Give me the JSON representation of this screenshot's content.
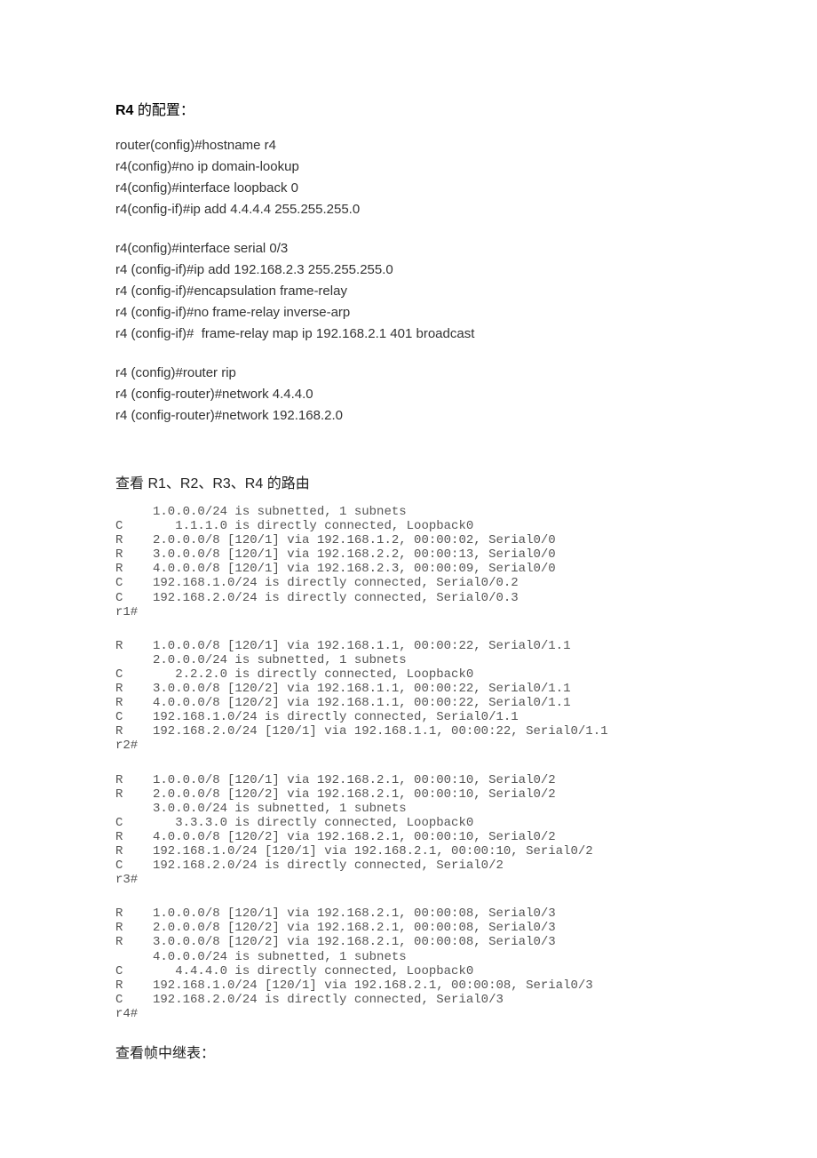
{
  "heading": {
    "bold": "R4",
    "rest": " 的配置："
  },
  "block1": [
    "router(config)#hostname r4",
    "r4(config)#no ip domain-lookup",
    "r4(config)#interface loopback 0",
    "r4(config-if)#ip add 4.4.4.4 255.255.255.0"
  ],
  "block2": [
    "r4(config)#interface serial 0/3",
    "r4 (config-if)#ip add 192.168.2.3 255.255.255.0",
    "r4 (config-if)#encapsulation frame-relay",
    "r4 (config-if)#no frame-relay inverse-arp",
    "r4 (config-if)#  frame-relay map ip 192.168.2.1 401 broadcast"
  ],
  "block3": [
    "r4 (config)#router rip",
    "r4 (config-router)#network 4.4.4.0",
    "r4 (config-router)#network 192.168.2.0"
  ],
  "sec_routes_title": "查看 R1、R2、R3、R4 的路由",
  "term1": "     1.0.0.0/24 is subnetted, 1 subnets\nC       1.1.1.0 is directly connected, Loopback0\nR    2.0.0.0/8 [120/1] via 192.168.1.2, 00:00:02, Serial0/0\nR    3.0.0.0/8 [120/1] via 192.168.2.2, 00:00:13, Serial0/0\nR    4.0.0.0/8 [120/1] via 192.168.2.3, 00:00:09, Serial0/0\nC    192.168.1.0/24 is directly connected, Serial0/0.2\nC    192.168.2.0/24 is directly connected, Serial0/0.3\nr1#",
  "term2": "R    1.0.0.0/8 [120/1] via 192.168.1.1, 00:00:22, Serial0/1.1\n     2.0.0.0/24 is subnetted, 1 subnets\nC       2.2.2.0 is directly connected, Loopback0\nR    3.0.0.0/8 [120/2] via 192.168.1.1, 00:00:22, Serial0/1.1\nR    4.0.0.0/8 [120/2] via 192.168.1.1, 00:00:22, Serial0/1.1\nC    192.168.1.0/24 is directly connected, Serial0/1.1\nR    192.168.2.0/24 [120/1] via 192.168.1.1, 00:00:22, Serial0/1.1\nr2#",
  "term3": "R    1.0.0.0/8 [120/1] via 192.168.2.1, 00:00:10, Serial0/2\nR    2.0.0.0/8 [120/2] via 192.168.2.1, 00:00:10, Serial0/2\n     3.0.0.0/24 is subnetted, 1 subnets\nC       3.3.3.0 is directly connected, Loopback0\nR    4.0.0.0/8 [120/2] via 192.168.2.1, 00:00:10, Serial0/2\nR    192.168.1.0/24 [120/1] via 192.168.2.1, 00:00:10, Serial0/2\nC    192.168.2.0/24 is directly connected, Serial0/2\nr3#",
  "term4": "R    1.0.0.0/8 [120/1] via 192.168.2.1, 00:00:08, Serial0/3\nR    2.0.0.0/8 [120/2] via 192.168.2.1, 00:00:08, Serial0/3\nR    3.0.0.0/8 [120/2] via 192.168.2.1, 00:00:08, Serial0/3\n     4.0.0.0/24 is subnetted, 1 subnets\nC       4.4.4.0 is directly connected, Loopback0\nR    192.168.1.0/24 [120/1] via 192.168.2.1, 00:00:08, Serial0/3\nC    192.168.2.0/24 is directly connected, Serial0/3\nr4#",
  "sec_frame_title": "查看帧中继表："
}
